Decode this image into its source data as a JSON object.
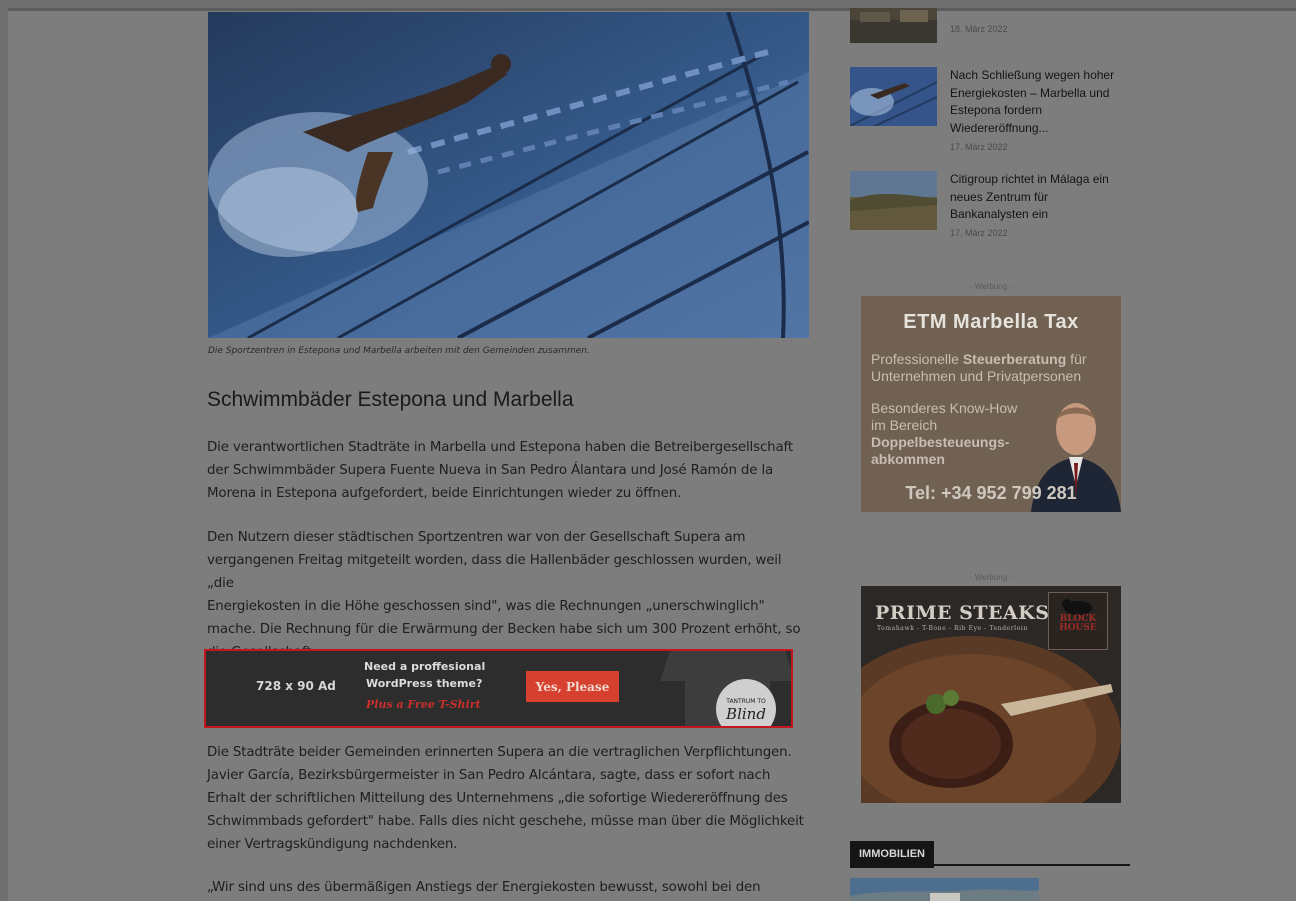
{
  "article": {
    "caption": "Die Sportzentren in Estepona und Marbella arbeiten mit den Gemeinden zusammen.",
    "heading": "Schwimmbäder Estepona und Marbella",
    "paragraphs": [
      [
        "Die verantwortlichen Stadträte in Marbella und Estepona haben die Betreibergesellschaft",
        "der Schwimmbäder Supera Fuente Nueva in San Pedro Álantara und José Ramón de la",
        "Morena in Estepona  aufgefordert, beide Einrichtungen wieder zu öffnen."
      ],
      [
        "Den Nutzern dieser städtischen Sportzentren war von der Gesellschaft Supera am",
        "vergangenen Freitag mitgeteilt worden, dass die Hallenbäder geschlossen wurden, weil „die",
        "Energiekosten in die Höhe geschossen sind\", was die Rechnungen „unerschwinglich\"",
        "mache. Die Rechnung für die Erwärmung der Becken habe sich um 300 Prozent erhöht, so",
        "die Gesellschaft."
      ],
      [
        "Die Stadträte beider Gemeinden erinnerten Supera an die vertraglichen Verpflichtungen.",
        "Javier García, Bezirksbürgermeister in San Pedro Alcántara, sagte, dass er sofort nach",
        "Erhalt der schriftlichen Mitteilung des Unternehmens „die sofortige Wiedereröffnung des",
        "Schwimmbads gefordert\" habe. Falls dies nicht geschehe, müsse man über die Möglichkeit",
        "einer Vertragskündigung nachdenken."
      ],
      [
        "„Wir sind uns des übermäßigen Anstiegs der Energiekosten bewusst, sowohl bei den"
      ]
    ]
  },
  "ad": {
    "size": "728 x 90 Ad",
    "line1": "Need a proffesional",
    "line2": "WordPress theme?",
    "line3": "Plus a Free T-Shirt",
    "button": "Yes, Please",
    "shirt_text1": "TANTRUM TO",
    "shirt_text2": "Blind"
  },
  "sidebar": {
    "items": [
      {
        "title": "",
        "date": "18. März 2022"
      },
      {
        "title": "Nach Schließung wegen hoher Energiekosten – Marbella und Estepona fordern Wiedereröffnung...",
        "date": "17. März 2022"
      },
      {
        "title": "Citigroup richtet in Málaga ein neues Zentrum für Bankanalysten ein",
        "date": "17. März 2022"
      }
    ],
    "ad_label": "- Werbung -",
    "etm": {
      "title": "ETM Marbella Tax",
      "line1a": "Professionelle ",
      "line1b": "Steuerberatung",
      "line1c": " für",
      "line2": "Unternehmen und Privatpersonen",
      "line3": "Besonderes Know-How",
      "line4": "im Bereich",
      "line5": "Doppelbesteueungs-",
      "line6": "abkommen",
      "tel": "Tel: +34 952 799 281"
    },
    "steaks": {
      "title": "PRIME STEAKS",
      "subtitle": "Tomahawk  -  T-Bone  -  Rib Eye  -  Tenderloin",
      "logo1": "BLOCK",
      "logo2": "HOUSE"
    },
    "category": "IMMOBILIEN"
  },
  "colors": {
    "overlay_bg": "#7d7d7d",
    "ad_border": "#c4161c",
    "ad_button": "#d6402f",
    "category_tab": "#151515"
  }
}
